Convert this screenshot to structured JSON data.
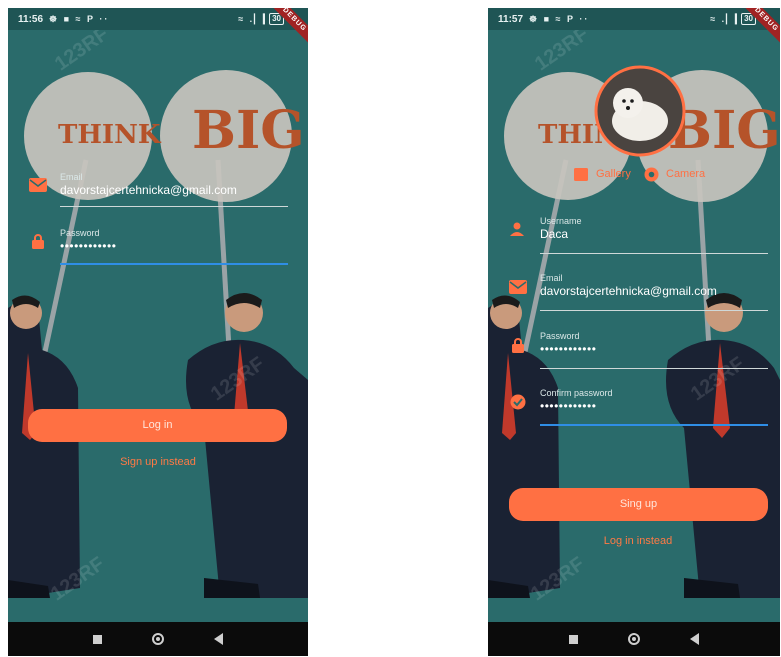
{
  "left_screen": {
    "status": {
      "time": "11:56",
      "icons": "☸ ■ ≈ P ··",
      "right_icons": "≈ .▏▎",
      "battery": "30",
      "ribbon": "DEBUG"
    },
    "sign_text": {
      "left": "THINK",
      "right": "BIG"
    },
    "email": {
      "label": "Email",
      "value": "davorstajcertehnicka@gmail.com"
    },
    "password": {
      "label": "Password",
      "value": "••••••••••••"
    },
    "login_button": "Log in",
    "signup_link": "Sign up instead",
    "watermark": "123RF"
  },
  "right_screen": {
    "status": {
      "time": "11:57",
      "icons": "☸ ■ ≈ P ··",
      "right_icons": "≈ .▏▎",
      "battery": "30",
      "ribbon": "DEBUG"
    },
    "sign_text": {
      "left": "THINK",
      "right": "BIG"
    },
    "gallery_label": "Gallery",
    "camera_label": "Camera",
    "username": {
      "label": "Username",
      "value": "Daca"
    },
    "email": {
      "label": "Email",
      "value": "davorstajcertehnicka@gmail.com"
    },
    "password": {
      "label": "Password",
      "value": "••••••••••••"
    },
    "confirm_password": {
      "label": "Confirm password",
      "value": "••••••••••••"
    },
    "signup_button": "Sing up",
    "login_link": "Log in instead",
    "watermark": "123RF"
  },
  "colors": {
    "background": "#2a6b6b",
    "accent": "#ff7043",
    "focus_line": "#2f8ee6"
  }
}
